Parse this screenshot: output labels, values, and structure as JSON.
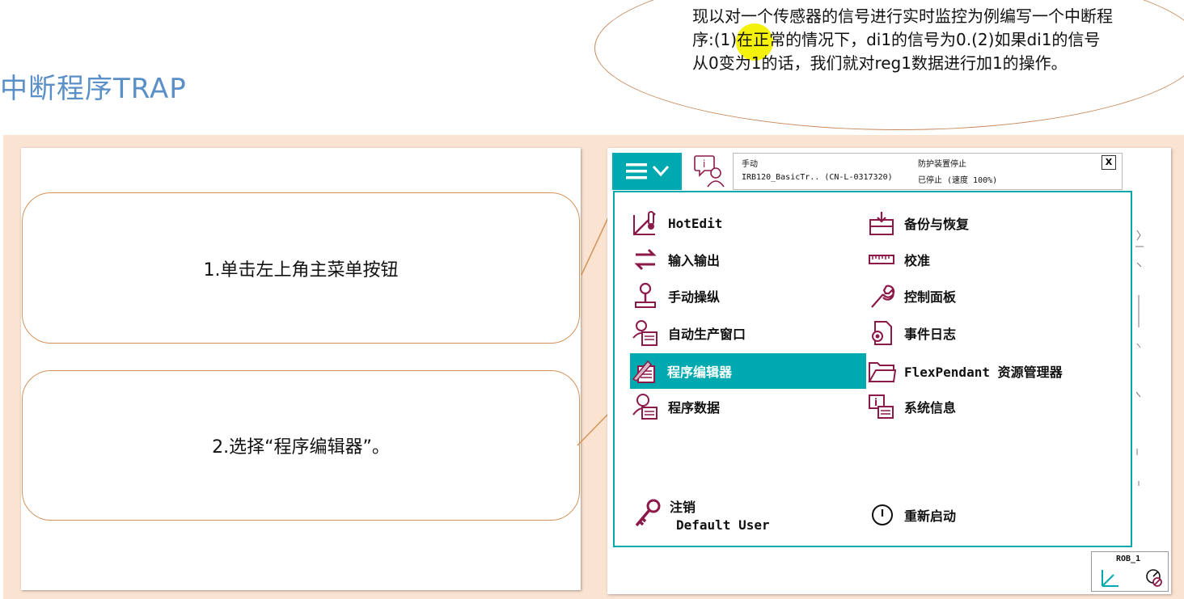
{
  "slide": {
    "title": "中断程序TRAP",
    "note": "现以对一个传感器的信号进行实时监控为例编写一个中断程序:(1)在正常的情况下，di1的信号为0.(2)如果di1的信号从0变为1的话，我们就对reg1数据进行加1的操作。"
  },
  "steps": [
    {
      "label": "1.单击左上角主菜单按钮"
    },
    {
      "label": "2.选择“程序编辑器”。"
    }
  ],
  "flexpendant": {
    "status": {
      "mode": "手动",
      "system": "IRB120_BasicTr.. (CN-L-0317320)",
      "safety": "防护装置停止",
      "state": "已停止 (速度 100%)"
    },
    "close_label": "X",
    "menu_left": [
      {
        "label": "HotEdit",
        "icon": "hotedit-icon"
      },
      {
        "label": "输入输出",
        "icon": "io-icon"
      },
      {
        "label": "手动操纵",
        "icon": "jogging-icon"
      },
      {
        "label": "自动生产窗口",
        "icon": "production-window-icon"
      },
      {
        "label": "程序编辑器",
        "icon": "program-editor-icon",
        "selected": true
      },
      {
        "label": "程序数据",
        "icon": "program-data-icon"
      }
    ],
    "menu_right": [
      {
        "label": "备份与恢复",
        "icon": "backup-restore-icon"
      },
      {
        "label": "校准",
        "icon": "calibration-icon"
      },
      {
        "label": "控制面板",
        "icon": "control-panel-icon"
      },
      {
        "label": "事件日志",
        "icon": "event-log-icon"
      },
      {
        "label": "FlexPendant 资源管理器",
        "icon": "explorer-icon"
      },
      {
        "label": "系统信息",
        "icon": "system-info-icon"
      }
    ],
    "logoff": {
      "label": "注销",
      "user": "Default User"
    },
    "restart": {
      "label": "重新启动"
    },
    "task": {
      "label": "ROB_1"
    },
    "colors": {
      "accent": "#00a9b0",
      "icon": "#8b1a4a",
      "connector": "#d4935a"
    }
  }
}
